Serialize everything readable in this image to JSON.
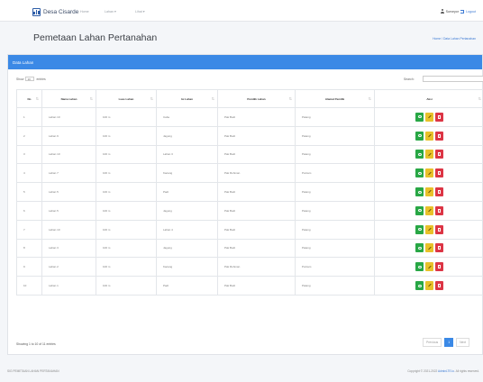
{
  "navbar": {
    "brand": "Desa Cisarde",
    "items": [
      "Home",
      "Lahan ▾",
      "Lihat ▾"
    ],
    "user": "Surveyor",
    "login": "Logout"
  },
  "page": {
    "title": "Pemetaan Lahan Pertanahan",
    "breadcrumb": "Home / Data Lahan Pertanahan"
  },
  "card": {
    "header": "Data Lahan",
    "show_prefix": "Show",
    "show_value": "10",
    "show_suffix": "entries",
    "search_label": "Search:"
  },
  "table": {
    "columns": [
      "No",
      "Nama Lahan",
      "Luas Lahan",
      "Isi Lahan",
      "Pemilik Lahan",
      "Alamat Pemilik",
      "Aksi"
    ],
    "rows": [
      [
        "1",
        "Lahan 10",
        "100 m",
        "Cabe",
        "Pak Budi",
        "Patang",
        ""
      ],
      [
        "2",
        "Lahan 9",
        "100 m",
        "Jagung",
        "Pak Budi",
        "Patang",
        ""
      ],
      [
        "3",
        "Lahan 10",
        "100 m",
        "Lahan 3",
        "Pak Budi",
        "Patang",
        ""
      ],
      [
        "4",
        "Lahan 7",
        "100 m",
        "Kacang",
        "Pak Rohman",
        "Puntam",
        ""
      ],
      [
        "5",
        "Lahan 5",
        "100 m",
        "Padi",
        "Pak Budi",
        "Patang",
        ""
      ],
      [
        "6",
        "Lahan 5",
        "100 m",
        "Jagung",
        "Pak Budi",
        "Patang",
        ""
      ],
      [
        "7",
        "Lahan 10",
        "100 m",
        "Lahan 4",
        "Pak Budi",
        "Patang",
        ""
      ],
      [
        "8",
        "Lahan 3",
        "100 m",
        "Jagung",
        "Pak Budi",
        "Patang",
        ""
      ],
      [
        "9",
        "Lahan 2",
        "100 m",
        "Kacang",
        "Pak Rohman",
        "Puntam",
        ""
      ],
      [
        "10",
        "Lahan 1",
        "100 m",
        "Padi",
        "Pak Budi",
        "Patang",
        ""
      ]
    ]
  },
  "footer": {
    "showing": "Showing 1 to 10 of 11 entries",
    "prev": "Previous",
    "page": "1",
    "next": "Next",
    "left": "SIG PEMETAAN LAHAN PERTANAHAN",
    "right_prefix": "Copyright © 2021-2022",
    "right_link": "AdminLTE.io",
    "right_suffix": "All rights reserved."
  },
  "colors": {
    "accent": "#3b89e6",
    "view": "#28a745",
    "edit": "#e8c12a",
    "delete": "#dc3545"
  },
  "icons": {
    "view": "eye-icon",
    "edit": "pencil-icon",
    "delete": "trash-icon"
  }
}
